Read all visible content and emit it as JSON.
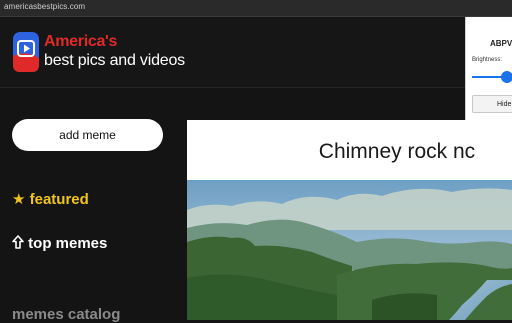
{
  "browser": {
    "url": "americasbestpics.com"
  },
  "header": {
    "brand_line1": "America's",
    "brand_line2": "best pics and videos",
    "logo_icon": "video-play-icon"
  },
  "extension": {
    "title": "ABPV E",
    "brightness_label": "Brightness:",
    "brightness_level": 0.6,
    "hide_button_label": "Hide N"
  },
  "sidebar": {
    "add_meme_label": "add meme",
    "items": [
      {
        "label": "featured",
        "icon": "star-icon"
      },
      {
        "label": "top memes",
        "icon": "arrow-up-icon"
      },
      {
        "label": "memes catalog"
      }
    ]
  },
  "post": {
    "title": "Chimney rock nc",
    "image": "mountain-lake-landscape"
  },
  "colors": {
    "accent_red": "#e02a2a",
    "featured_yellow": "#f0c419",
    "background": "#141414",
    "slider_blue": "#1a73e8"
  }
}
